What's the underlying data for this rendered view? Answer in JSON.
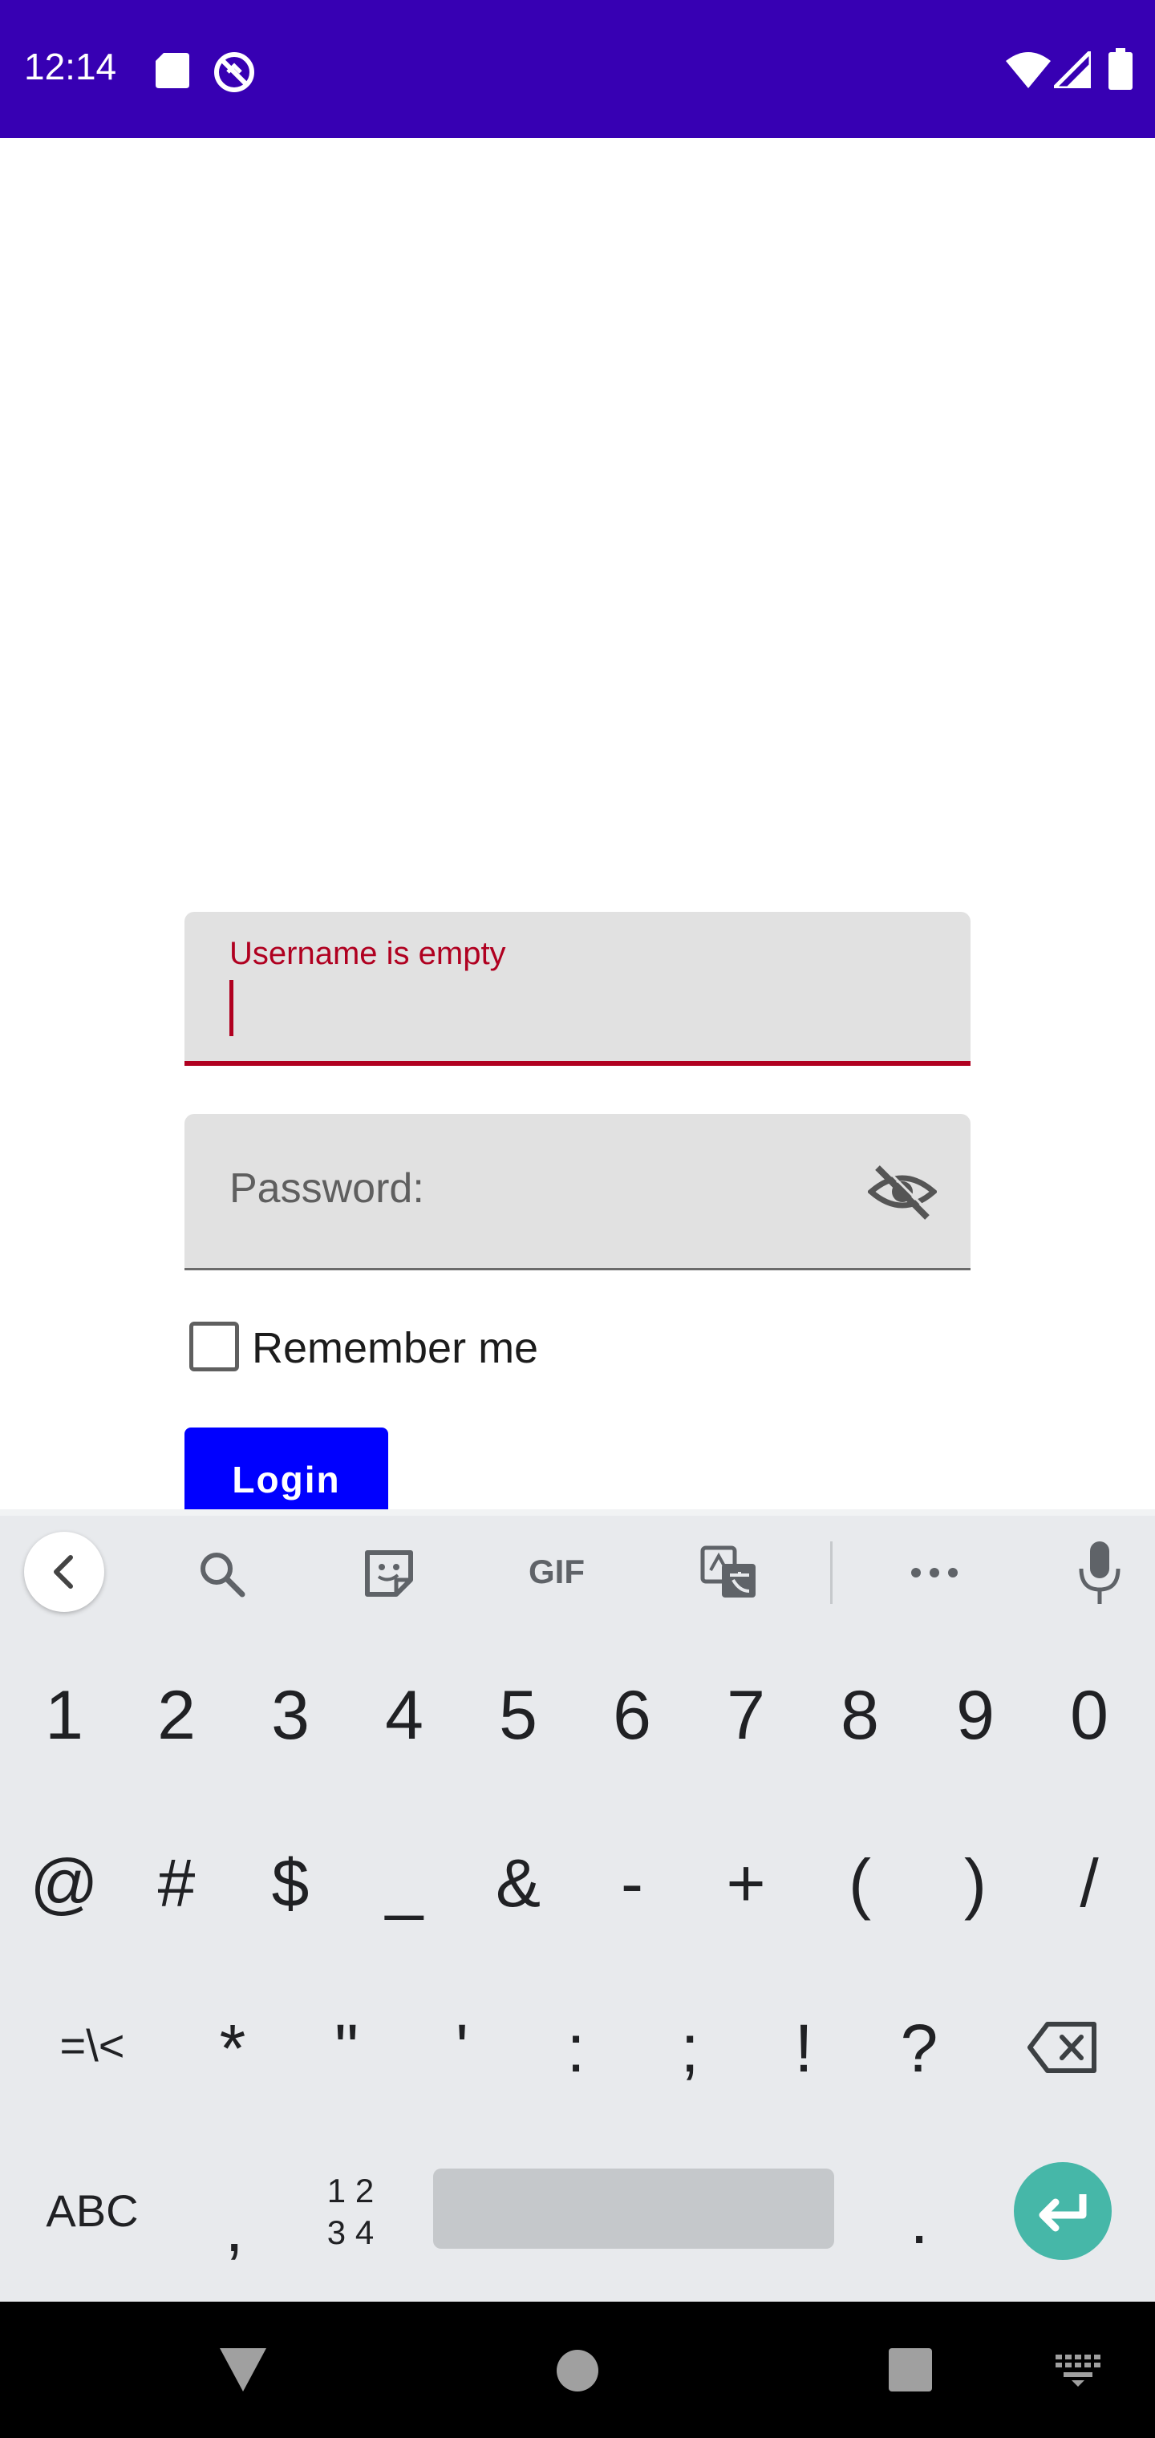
{
  "status_bar": {
    "time": "12:14",
    "bg": "#3700b3"
  },
  "form": {
    "username_error": "Username is empty",
    "password_label": "Password:",
    "remember_label": "Remember me",
    "login_label": "Login",
    "error_color": "#b00020",
    "button_color": "#0000ff"
  },
  "keyboard": {
    "toolbar": [
      "back-icon",
      "search-icon",
      "sticker-icon",
      "gif-icon",
      "translate-icon",
      "more-icon",
      "mic-icon"
    ],
    "gif_label": "GIF",
    "row1": [
      "1",
      "2",
      "3",
      "4",
      "5",
      "6",
      "7",
      "8",
      "9",
      "0"
    ],
    "row2": [
      "@",
      "#",
      "$",
      "_",
      "&",
      "-",
      "+",
      "(",
      ")",
      "/"
    ],
    "row3": [
      "=\\<",
      "*",
      "\"",
      "'",
      ":",
      ";",
      "!",
      "?"
    ],
    "abc_label": "ABC",
    "comma": ",",
    "numpad_top": "1 2",
    "numpad_bottom": "3 4",
    "period": "."
  }
}
